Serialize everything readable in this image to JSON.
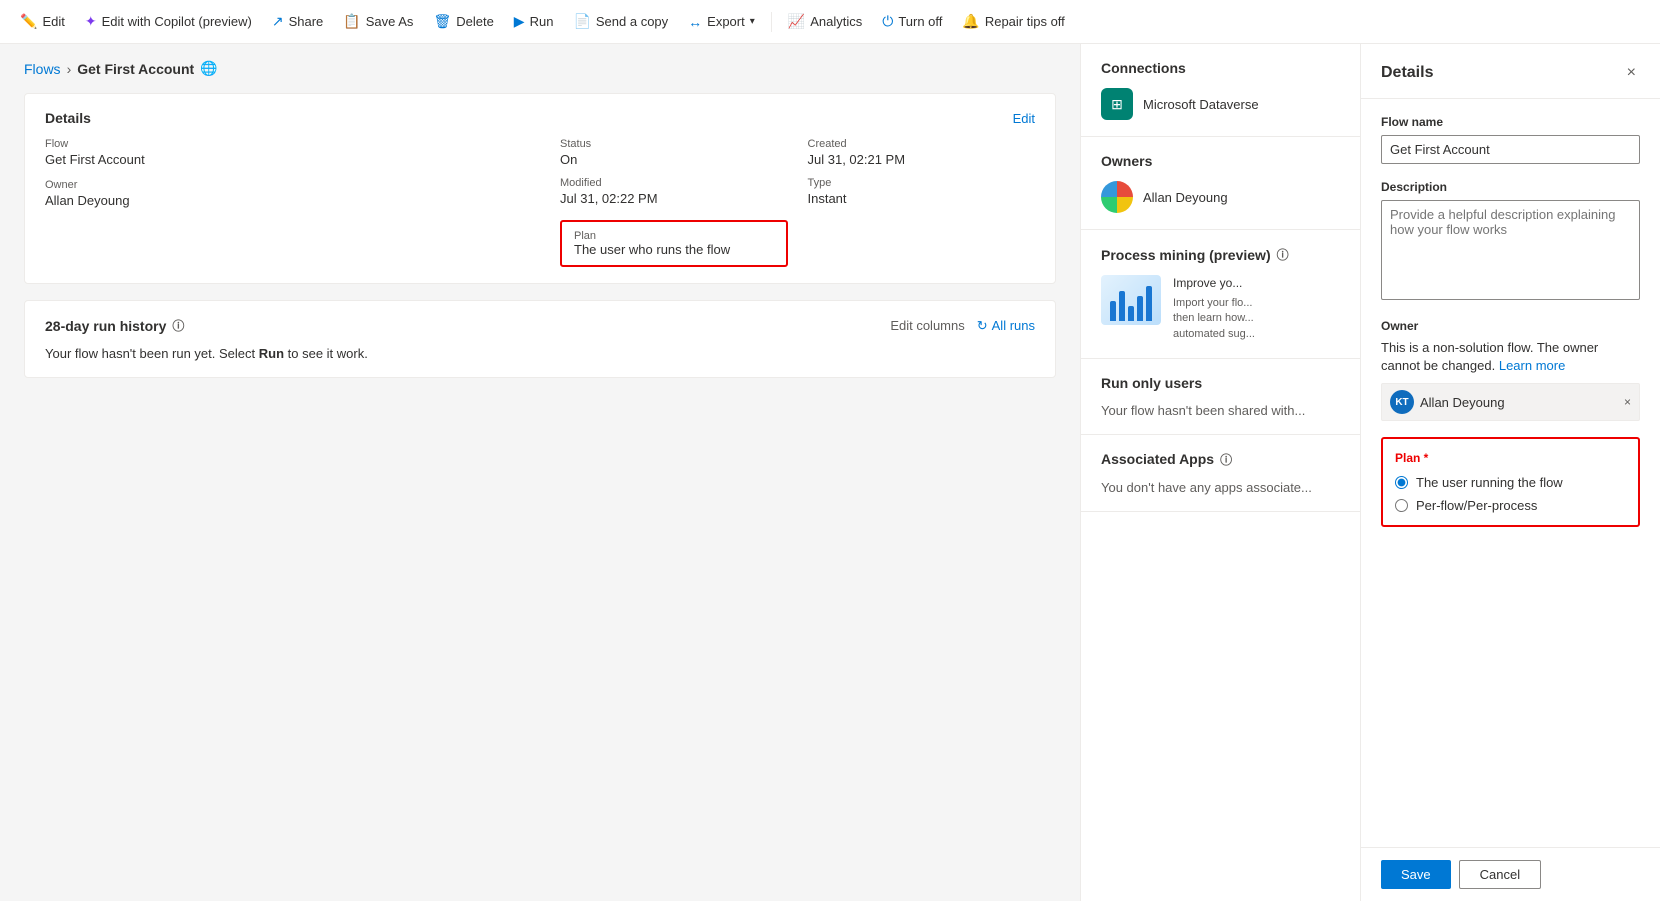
{
  "toolbar": {
    "items": [
      {
        "id": "edit",
        "label": "Edit",
        "icon": "✏️"
      },
      {
        "id": "edit-copilot",
        "label": "Edit with Copilot (preview)",
        "icon": "✦"
      },
      {
        "id": "share",
        "label": "Share",
        "icon": "↗"
      },
      {
        "id": "save-as",
        "label": "Save As",
        "icon": "📋"
      },
      {
        "id": "delete",
        "label": "Delete",
        "icon": "🗑"
      },
      {
        "id": "run",
        "label": "Run",
        "icon": "▶"
      },
      {
        "id": "send-copy",
        "label": "Send a copy",
        "icon": "📄"
      },
      {
        "id": "export",
        "label": "Export",
        "icon": "↔"
      },
      {
        "id": "analytics",
        "label": "Analytics",
        "icon": "📈"
      },
      {
        "id": "turn-off",
        "label": "Turn off",
        "icon": "⏻"
      },
      {
        "id": "repair-tips",
        "label": "Repair tips off",
        "icon": "🔔"
      }
    ]
  },
  "breadcrumb": {
    "parent": "Flows",
    "current": "Get First Account"
  },
  "details_card": {
    "title": "Details",
    "edit_label": "Edit",
    "flow_label": "Flow",
    "flow_value": "Get First Account",
    "owner_label": "Owner",
    "owner_value": "Allan Deyoung",
    "status_label": "Status",
    "status_value": "On",
    "created_label": "Created",
    "created_value": "Jul 31, 02:21 PM",
    "modified_label": "Modified",
    "modified_value": "Jul 31, 02:22 PM",
    "type_label": "Type",
    "type_value": "Instant",
    "plan_label": "Plan",
    "plan_value": "The user who runs the flow"
  },
  "run_history": {
    "title": "28-day run history",
    "edit_columns": "Edit columns",
    "all_runs": "All runs",
    "empty_message": "Your flow hasn't been run yet. Select ",
    "empty_run": "Run",
    "empty_suffix": " to see it work."
  },
  "connections": {
    "title": "Connections",
    "items": [
      {
        "name": "Microsoft Dataverse",
        "icon": "⊞"
      }
    ]
  },
  "owners": {
    "title": "Owners",
    "items": [
      {
        "name": "Allan Deyoung"
      }
    ]
  },
  "process_mining": {
    "title": "Process mining (preview)",
    "description": "Improve yo... Import your flo... then learn how... automated sug..."
  },
  "run_only_users": {
    "title": "Run only users",
    "message": "Your flow hasn't been shared with..."
  },
  "associated_apps": {
    "title": "Associated Apps",
    "message": "You don't have any apps associate..."
  },
  "details_panel": {
    "title": "Details",
    "close_label": "×",
    "flow_name_label": "Flow name",
    "flow_name_value": "Get First Account",
    "description_label": "Description",
    "description_placeholder": "Provide a helpful description explaining how your flow works",
    "owner_label": "Owner",
    "owner_text": "This is a non-solution flow. The owner cannot be changed.",
    "learn_more_label": "Learn more",
    "owner_name": "Allan Deyoung",
    "owner_initials": "KT",
    "plan_label": "Plan",
    "plan_required": "*",
    "plan_options": [
      {
        "id": "user-running",
        "label": "The user running the flow",
        "checked": true
      },
      {
        "id": "per-flow",
        "label": "Per-flow/Per-process",
        "checked": false
      }
    ],
    "save_label": "Save",
    "cancel_label": "Cancel"
  }
}
